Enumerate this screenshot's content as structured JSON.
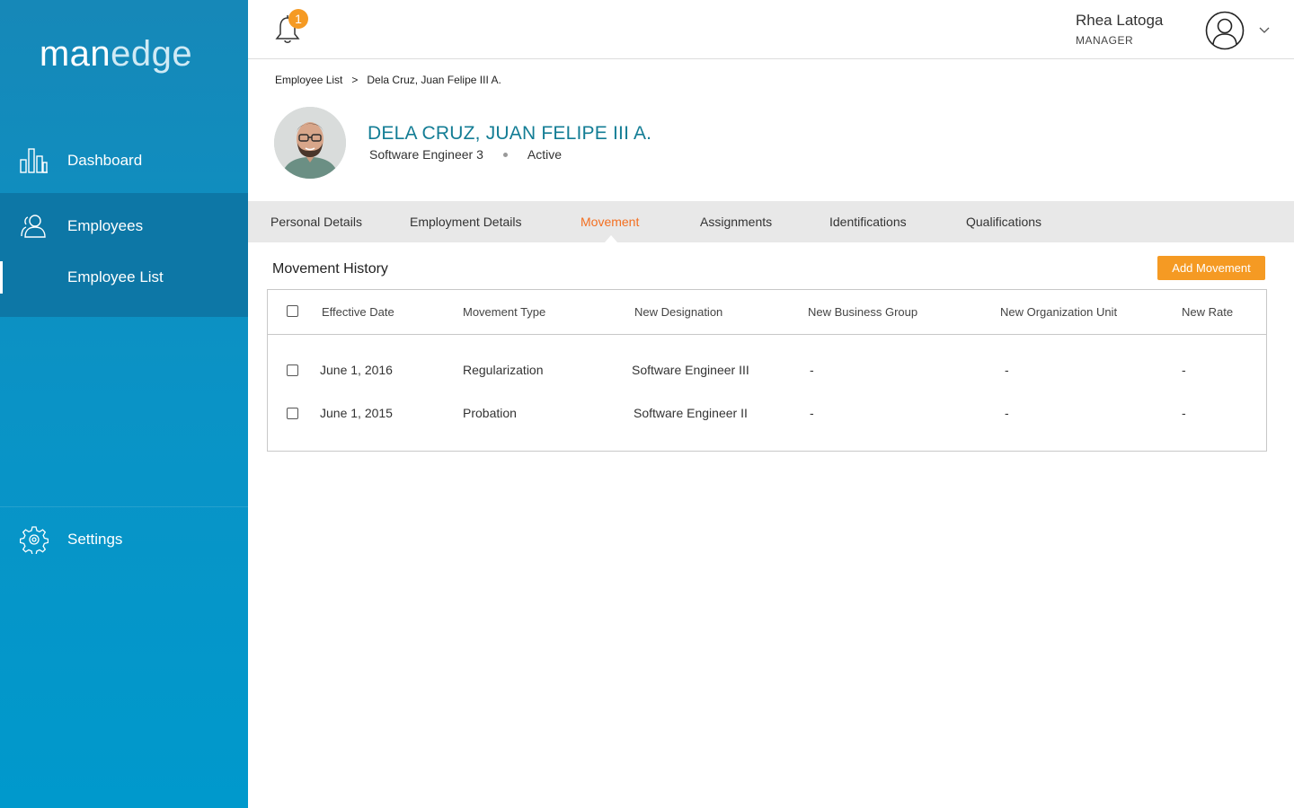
{
  "app": {
    "logo_bold": "man",
    "logo_light": "edge"
  },
  "sidebar": {
    "dashboard": "Dashboard",
    "employees": "Employees",
    "employee_list": "Employee List",
    "settings": "Settings"
  },
  "header": {
    "notification_count": "1",
    "user_name": "Rhea Latoga",
    "user_role": "MANAGER"
  },
  "breadcrumb": {
    "parent": "Employee List",
    "separator": ">",
    "current": "Dela Cruz,  Juan Felipe III  A."
  },
  "employee": {
    "name": "DELA CRUZ, JUAN FELIPE III A.",
    "position": "Software Engineer 3",
    "status": "Active"
  },
  "tabs": [
    {
      "label": "Personal Details"
    },
    {
      "label": "Employment Details"
    },
    {
      "label": "Movement",
      "active": true
    },
    {
      "label": "Assignments"
    },
    {
      "label": "Identifications"
    },
    {
      "label": "Qualifications"
    }
  ],
  "movement": {
    "title": "Movement History",
    "add_button": "Add Movement",
    "columns": [
      "Effective Date",
      "Movement Type",
      "New Designation",
      "New Business Group",
      "New Organization Unit",
      "New Rate"
    ],
    "rows": [
      {
        "date": "June 1, 2016",
        "type": "Regularization",
        "designation": "Software Engineer III",
        "business_group": "-",
        "org_unit": "-",
        "rate": "-"
      },
      {
        "date": "June 1, 2015",
        "type": "Probation",
        "designation": "Software Engineer II",
        "business_group": "-",
        "org_unit": "-",
        "rate": "-"
      }
    ]
  },
  "colors": {
    "sidebar_blue": "#0a93c6",
    "sidebar_active": "#0d77a6",
    "accent_orange": "#f59a23",
    "active_tab": "#f36f21",
    "name_teal": "#137d95"
  },
  "icons": {
    "dashboard": "bar-chart-icon",
    "employees": "users-icon",
    "settings": "gear-icon",
    "notifications": "bell-icon",
    "user": "user-avatar-icon",
    "dropdown": "chevron-down-icon"
  }
}
